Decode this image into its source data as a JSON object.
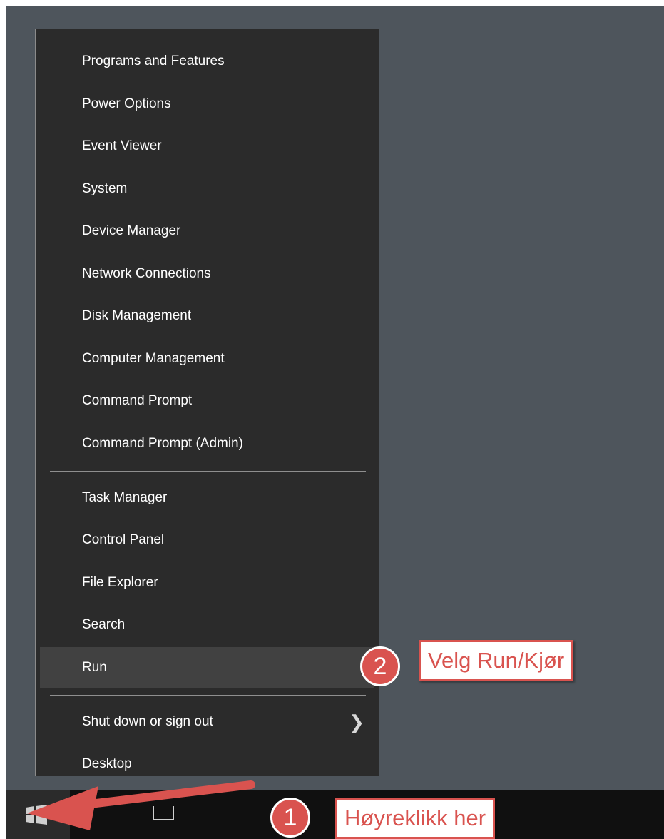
{
  "menu": {
    "group1": [
      "Programs and Features",
      "Power Options",
      "Event Viewer",
      "System",
      "Device Manager",
      "Network Connections",
      "Disk Management",
      "Computer Management",
      "Command Prompt",
      "Command Prompt (Admin)"
    ],
    "group2": [
      "Task Manager",
      "Control Panel",
      "File Explorer",
      "Search",
      "Run"
    ],
    "group3": [
      "Shut down or sign out",
      "Desktop"
    ],
    "highlighted": "Run"
  },
  "annotations": {
    "step1_number": "1",
    "step1_label": "Høyreklikk her",
    "step2_number": "2",
    "step2_label": "Velg Run/Kjør"
  },
  "colors": {
    "desktop": "#4e555c",
    "menu_bg": "#2b2b2b",
    "hover_bg": "#414141",
    "taskbar": "#101010",
    "annotation_red": "#d9534f"
  },
  "icons": {
    "start": "windows-logo-icon",
    "submenu": "chevron-right-icon",
    "taskview": "task-view-icon"
  }
}
